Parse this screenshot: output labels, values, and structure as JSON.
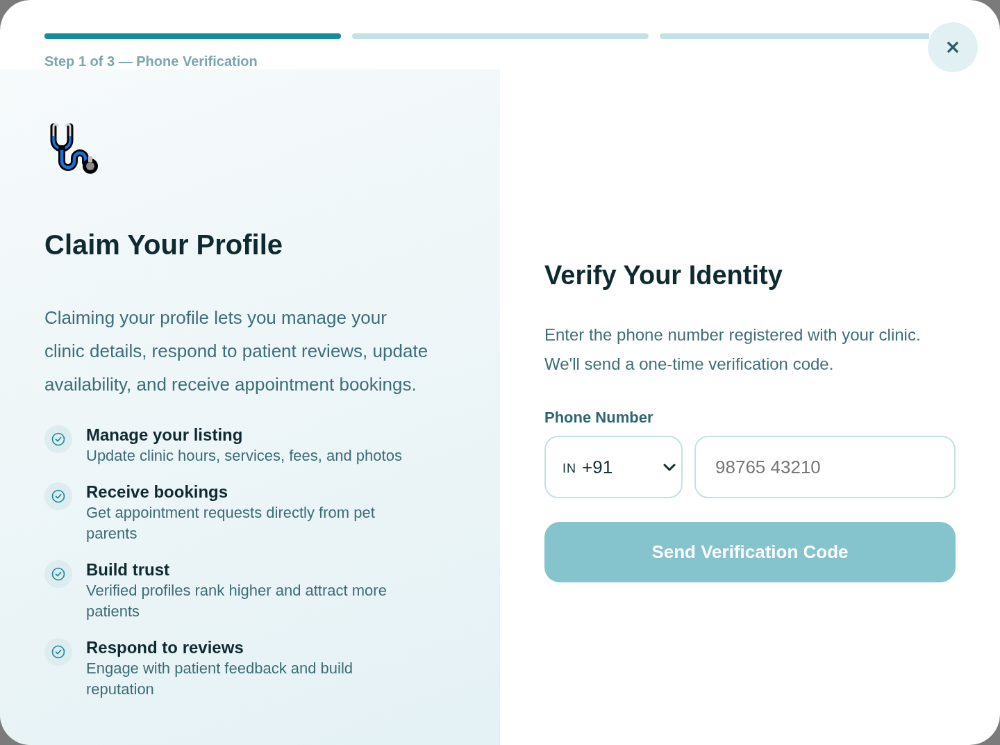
{
  "progress": {
    "steps": [
      {
        "active": true
      },
      {
        "active": false
      },
      {
        "active": false
      }
    ],
    "label": "Step 1 of 3 — Phone Verification"
  },
  "intro": {
    "title": "Claim Your Profile",
    "description": "Claiming your profile lets you manage your clinic details, respond to patient reviews, update availability, and receive appointment bookings.",
    "benefits": [
      {
        "title": "Manage your listing",
        "description": "Update clinic hours, services, fees, and photos"
      },
      {
        "title": "Receive bookings",
        "description": "Get appointment requests directly from pet parents"
      },
      {
        "title": "Build trust",
        "description": "Verified profiles rank higher and attract more patients"
      },
      {
        "title": "Respond to reviews",
        "description": "Engage with patient feedback and build reputation"
      }
    ]
  },
  "verify": {
    "title": "Verify Your Identity",
    "description": "Enter the phone number registered with your clinic. We'll send a one-time verification code.",
    "phone": {
      "label": "Phone Number",
      "country": "IN",
      "dial_code": "+91",
      "placeholder": "98765 43210"
    },
    "submit": {
      "label": "Send Verification Code",
      "disabled": true
    }
  }
}
